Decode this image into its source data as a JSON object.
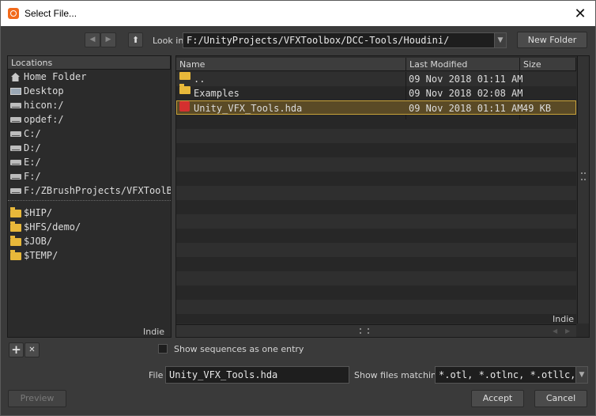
{
  "window": {
    "title": "Select File...",
    "close_glyph": "✕"
  },
  "toolbar": {
    "back_glyph": "◀",
    "forward_glyph": "▶",
    "up_glyph": "⬆",
    "look_in_label": "Look in",
    "path_value": "F:/UnityProjects/VFXToolbox/DCC-Tools/Houdini/",
    "dropdown_glyph": "▼",
    "new_folder_label": "New Folder"
  },
  "locations": {
    "header": "Locations",
    "items": [
      {
        "label": "Home Folder",
        "icon": "home-icon"
      },
      {
        "label": "Desktop",
        "icon": "desktop-icon"
      },
      {
        "label": "hicon:/",
        "icon": "drive-icon"
      },
      {
        "label": "opdef:/",
        "icon": "drive-icon"
      },
      {
        "label": "C:/",
        "icon": "drive-icon"
      },
      {
        "label": "D:/",
        "icon": "drive-icon"
      },
      {
        "label": "E:/",
        "icon": "drive-icon"
      },
      {
        "label": "F:/",
        "icon": "drive-icon"
      },
      {
        "label": "F:/ZBrushProjects/VFXToolB",
        "icon": "drive-icon"
      }
    ],
    "bookmarks": [
      {
        "label": "$HIP/",
        "icon": "folder-icon"
      },
      {
        "label": "$HFS/demo/",
        "icon": "folder-icon"
      },
      {
        "label": "$JOB/",
        "icon": "folder-icon"
      },
      {
        "label": "$TEMP/",
        "icon": "folder-icon"
      }
    ],
    "watermark": "Indie",
    "add_glyph": "+",
    "remove_glyph": "✕"
  },
  "files": {
    "columns": {
      "name": "Name",
      "modified": "Last Modified",
      "size": "Size"
    },
    "rows": [
      {
        "name": "..",
        "modified": "09 Nov 2018 01:11 AM",
        "size": "",
        "icon": "folder-icon"
      },
      {
        "name": "Examples",
        "modified": "09 Nov 2018 02:08 AM",
        "size": "",
        "icon": "folder-icon"
      },
      {
        "name": "Unity_VFX_Tools.hda",
        "modified": "09 Nov 2018 01:11 AM",
        "size": "49 KB",
        "icon": "hda-icon",
        "selected": true
      }
    ],
    "watermark": "Indie"
  },
  "options": {
    "show_sequences_label": "Show sequences as one entry",
    "show_sequences_checked": false
  },
  "footer": {
    "file_label": "File",
    "file_value": "Unity_VFX_Tools.hda",
    "filter_label": "Show files matching",
    "filter_value": "*.otl, *.otlnc, *.otllc,",
    "filter_dropdown_glyph": "▼",
    "preview_label": "Preview",
    "accept_label": "Accept",
    "cancel_label": "Cancel"
  }
}
